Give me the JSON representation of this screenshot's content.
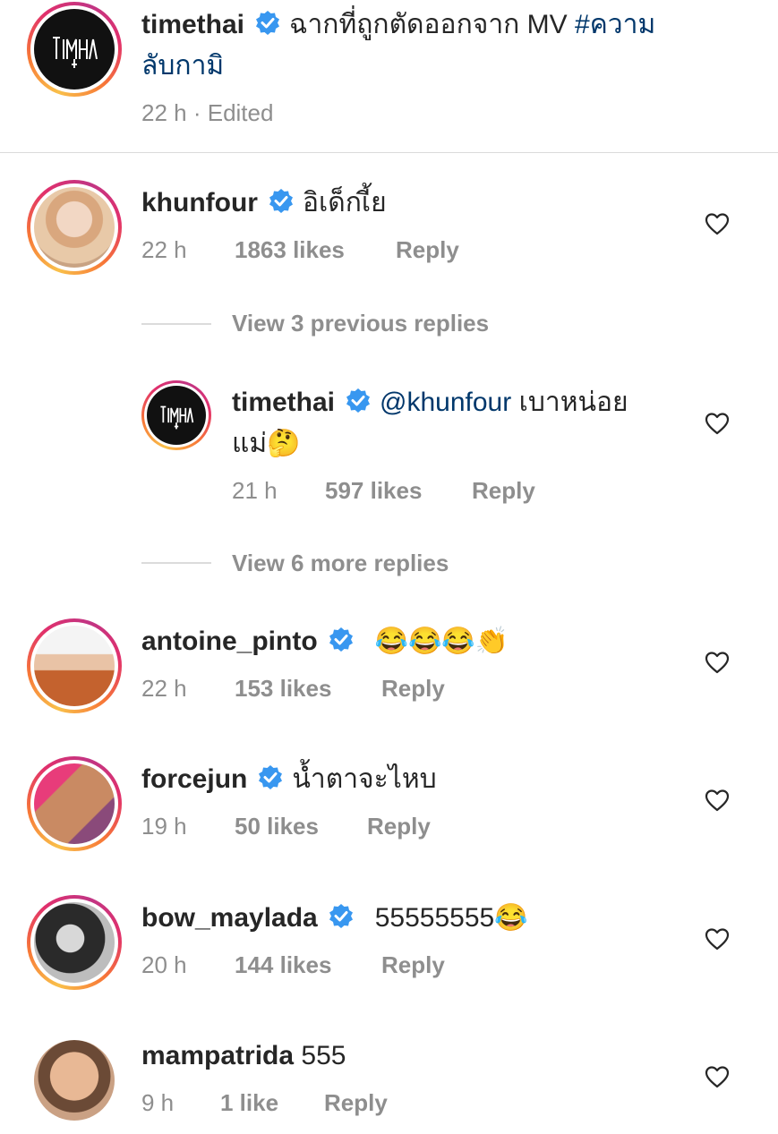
{
  "post": {
    "username": "timethai",
    "caption_line1": "ฉากที่ถูกตัดออกจาก MV",
    "hashtag_part1": "#ความ",
    "hashtag_part2": "ลับกามิ",
    "time": "22 h",
    "edited": "· Edited"
  },
  "comments": [
    {
      "username": "khunfour",
      "text": "อิเด็กเี้ย",
      "time": "22 h",
      "likes": "1863 likes",
      "reply": "Reply"
    },
    {
      "username": "antoine_pinto",
      "text": "😂😂😂👏",
      "time": "22 h",
      "likes": "153 likes",
      "reply": "Reply"
    },
    {
      "username": "forcejun",
      "text": "น้ำตาจะไหบ",
      "time": "19 h",
      "likes": "50 likes",
      "reply": "Reply"
    },
    {
      "username": "bow_maylada",
      "text": "55555555😂",
      "time": "20 h",
      "likes": "144 likes",
      "reply": "Reply"
    },
    {
      "username": "mampatrida",
      "text": "555",
      "time": "9 h",
      "likes": "1 like",
      "reply": "Reply"
    }
  ],
  "thread": {
    "view_previous": "View 3 previous replies",
    "view_more": "View 6 more replies",
    "reply": {
      "username": "timethai",
      "mention": "@khunfour",
      "text_line1": "เบาหน่อย",
      "text_line2": "แม่🤔",
      "time": "21 h",
      "likes": "597 likes",
      "reply": "Reply"
    }
  },
  "colors": {
    "verified": "#3897f0",
    "link": "#00376b",
    "meta": "#8e8e8e"
  },
  "icons": [
    "verified-badge-icon",
    "heart-icon"
  ]
}
